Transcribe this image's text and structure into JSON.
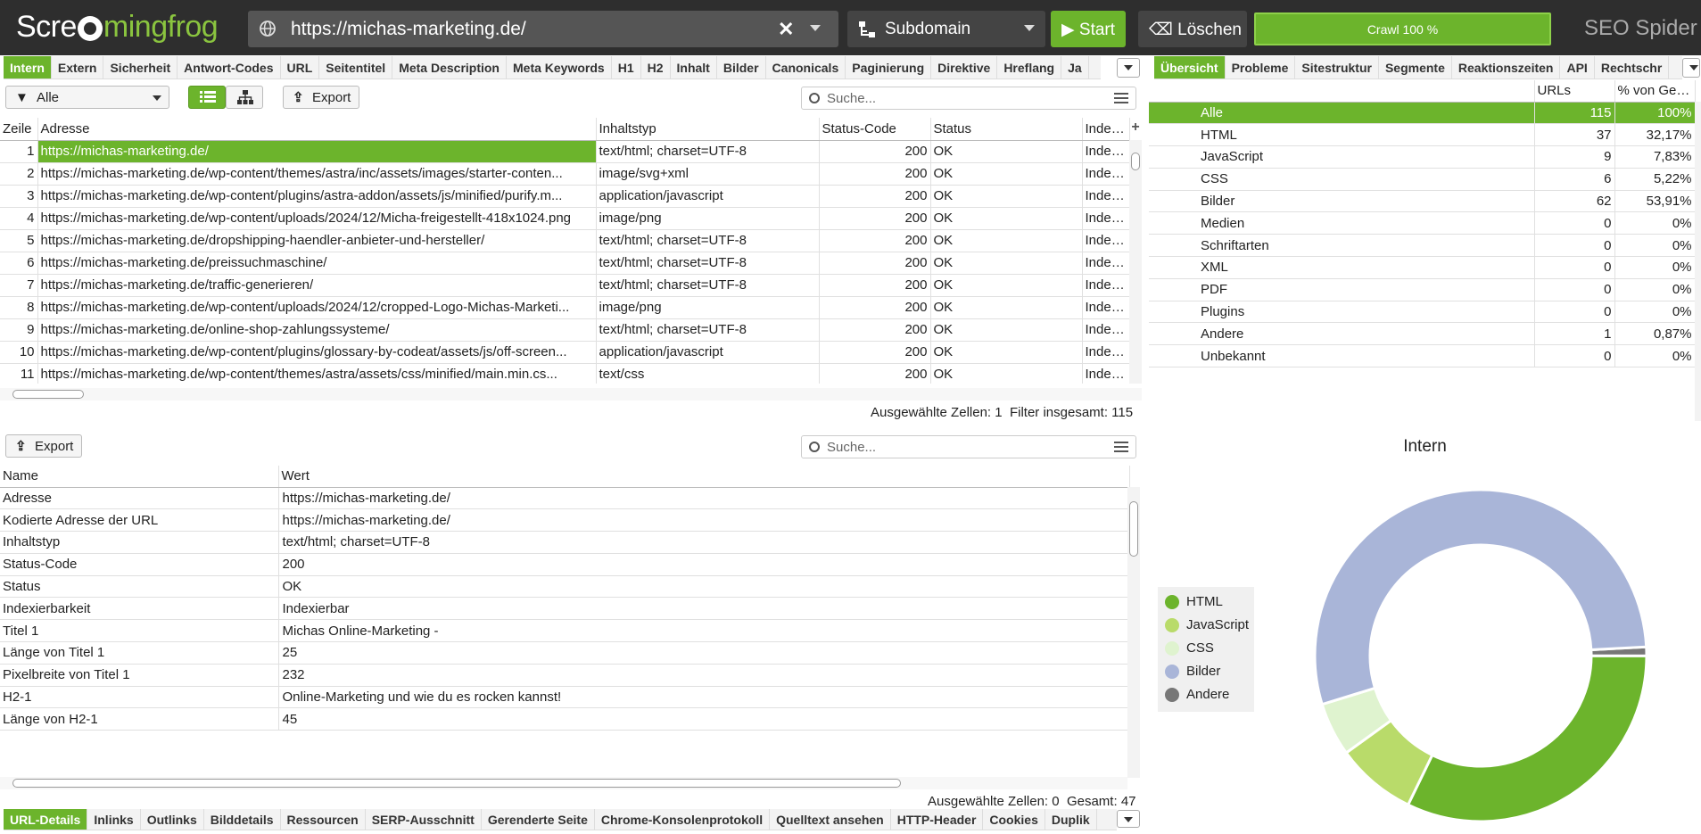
{
  "app": {
    "logo_prefix": "Scre",
    "logo_suffix": "mingfrog",
    "product": "SEO Spider",
    "url": "https://michas-marketing.de/",
    "mode": "Subdomain",
    "start_label": "Start",
    "clear_label": "Löschen",
    "crawl_status": "Crawl 100 %"
  },
  "main_tabs": [
    "Intern",
    "Extern",
    "Sicherheit",
    "Antwort-Codes",
    "URL",
    "Seitentitel",
    "Meta Description",
    "Meta Keywords",
    "H1",
    "H2",
    "Inhalt",
    "Bilder",
    "Canonicals",
    "Paginierung",
    "Direktive",
    "Hreflang",
    "Ja"
  ],
  "right_tabs": [
    "Übersicht",
    "Probleme",
    "Sitestruktur",
    "Segmente",
    "Reaktionszeiten",
    "API",
    "Rechtschr"
  ],
  "bottom_tabs": [
    "URL-Details",
    "Inlinks",
    "Outlinks",
    "Bilddetails",
    "Ressourcen",
    "SERP-Ausschnitt",
    "Gerenderte Seite",
    "Chrome-Konsolenprotokoll",
    "Quelltext ansehen",
    "HTTP-Header",
    "Cookies",
    "Duplik"
  ],
  "toolbar": {
    "filter": "Alle",
    "export": "Export",
    "search_placeholder": "Suche..."
  },
  "url_table": {
    "columns": [
      "Zeile",
      "Adresse",
      "Inhaltstyp",
      "Status-Code",
      "Status",
      "Indexie"
    ],
    "rows": [
      [
        "1",
        "https://michas-marketing.de/",
        "text/html; charset=UTF-8",
        "200",
        "OK",
        "Indexie"
      ],
      [
        "2",
        "https://michas-marketing.de/wp-content/themes/astra/inc/assets/images/starter-conten...",
        "image/svg+xml",
        "200",
        "OK",
        "Indexie"
      ],
      [
        "3",
        "https://michas-marketing.de/wp-content/plugins/astra-addon/assets/js/minified/purify.m...",
        "application/javascript",
        "200",
        "OK",
        "Indexie"
      ],
      [
        "4",
        "https://michas-marketing.de/wp-content/uploads/2024/12/Micha-freigestellt-418x1024.png",
        "image/png",
        "200",
        "OK",
        "Indexie"
      ],
      [
        "5",
        "https://michas-marketing.de/dropshipping-haendler-anbieter-und-hersteller/",
        "text/html; charset=UTF-8",
        "200",
        "OK",
        "Indexie"
      ],
      [
        "6",
        "https://michas-marketing.de/preissuchmaschine/",
        "text/html; charset=UTF-8",
        "200",
        "OK",
        "Indexie"
      ],
      [
        "7",
        "https://michas-marketing.de/traffic-generieren/",
        "text/html; charset=UTF-8",
        "200",
        "OK",
        "Indexie"
      ],
      [
        "8",
        "https://michas-marketing.de/wp-content/uploads/2024/12/cropped-Logo-Michas-Marketi...",
        "image/png",
        "200",
        "OK",
        "Indexie"
      ],
      [
        "9",
        "https://michas-marketing.de/online-shop-zahlungssysteme/",
        "text/html; charset=UTF-8",
        "200",
        "OK",
        "Indexie"
      ],
      [
        "10",
        "https://michas-marketing.de/wp-content/plugins/glossary-by-codeat/assets/js/off-screen...",
        "application/javascript",
        "200",
        "OK",
        "Indexie"
      ],
      [
        "11",
        "https://michas-marketing.de/wp-content/themes/astra/assets/css/minified/main.min.cs...",
        "text/css",
        "200",
        "OK",
        "Indexie"
      ]
    ],
    "status_label": "Ausgewählte Zellen:",
    "status_selected": "1",
    "status_total_label": "Filter insgesamt:",
    "status_total": "115"
  },
  "overview": {
    "columns": [
      "",
      "URLs",
      "% von Ges..."
    ],
    "rows": [
      [
        "Alle",
        "115",
        "100%"
      ],
      [
        "HTML",
        "37",
        "32,17%"
      ],
      [
        "JavaScript",
        "9",
        "7,83%"
      ],
      [
        "CSS",
        "6",
        "5,22%"
      ],
      [
        "Bilder",
        "62",
        "53,91%"
      ],
      [
        "Medien",
        "0",
        "0%"
      ],
      [
        "Schriftarten",
        "0",
        "0%"
      ],
      [
        "XML",
        "0",
        "0%"
      ],
      [
        "PDF",
        "0",
        "0%"
      ],
      [
        "Plugins",
        "0",
        "0%"
      ],
      [
        "Andere",
        "1",
        "0,87%"
      ],
      [
        "Unbekannt",
        "0",
        "0%"
      ]
    ]
  },
  "details": {
    "columns": [
      "Name",
      "Wert"
    ],
    "rows": [
      [
        "Adresse",
        "https://michas-marketing.de/"
      ],
      [
        "Kodierte Adresse der URL",
        "https://michas-marketing.de/"
      ],
      [
        "Inhaltstyp",
        "text/html; charset=UTF-8"
      ],
      [
        "Status-Code",
        "200"
      ],
      [
        "Status",
        "OK"
      ],
      [
        "Indexierbarkeit",
        "Indexierbar"
      ],
      [
        "Titel 1",
        "Michas Online-Marketing -"
      ],
      [
        "Länge von Titel 1",
        "25"
      ],
      [
        "Pixelbreite von Titel 1",
        "232"
      ],
      [
        "H2-1",
        "Online-Marketing und wie du es rocken kannst!"
      ],
      [
        "Länge von H2-1",
        "45"
      ]
    ],
    "status_label": "Ausgewählte Zellen:",
    "status_selected": "0",
    "status_total_label": "Gesamt:",
    "status_total": "47"
  },
  "chart_data": {
    "type": "pie",
    "title": "Intern",
    "categories": [
      "HTML",
      "JavaScript",
      "CSS",
      "Bilder",
      "Andere"
    ],
    "values": [
      37,
      9,
      6,
      62,
      1
    ],
    "colors": [
      "#6cb42c",
      "#b9db6a",
      "#dff3cf",
      "#a9b5d8",
      "#777777"
    ],
    "legend_position": "left"
  }
}
